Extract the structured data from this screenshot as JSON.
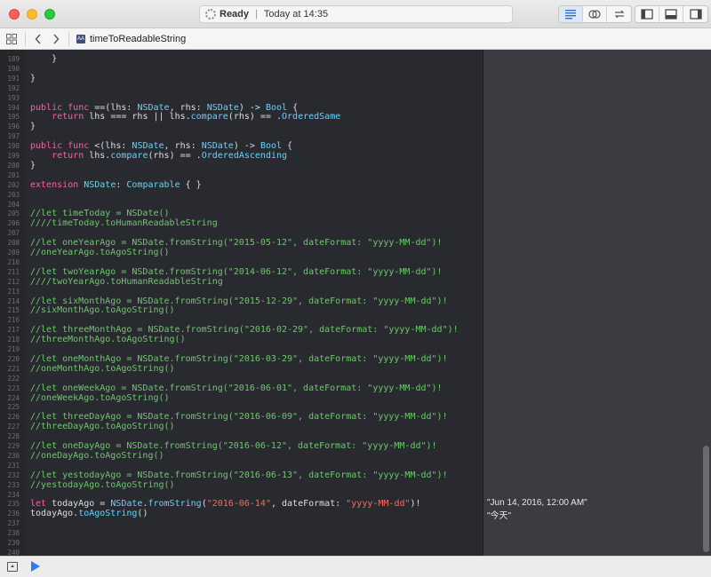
{
  "window": {
    "status": "Ready",
    "status_time": "Today at 14:35"
  },
  "jumpbar": {
    "filename": "timeToReadableString",
    "file_badge": "AA"
  },
  "editor": {
    "lines": [
      {
        "n": "189",
        "tokens": [
          {
            "t": "p",
            "v": "    }"
          }
        ]
      },
      {
        "n": "190",
        "tokens": []
      },
      {
        "n": "191",
        "tokens": [
          {
            "t": "p",
            "v": "}"
          }
        ]
      },
      {
        "n": "192",
        "tokens": []
      },
      {
        "n": "193",
        "tokens": []
      },
      {
        "n": "194",
        "tokens": [
          {
            "t": "kw",
            "v": "public"
          },
          {
            "t": "p",
            "v": " "
          },
          {
            "t": "kw",
            "v": "func"
          },
          {
            "t": "p",
            "v": " ==(lhs: "
          },
          {
            "t": "ty",
            "v": "NSDate"
          },
          {
            "t": "p",
            "v": ", rhs: "
          },
          {
            "t": "ty",
            "v": "NSDate"
          },
          {
            "t": "p",
            "v": ") -> "
          },
          {
            "t": "ty",
            "v": "Bool"
          },
          {
            "t": "p",
            "v": " {"
          }
        ]
      },
      {
        "n": "195",
        "tokens": [
          {
            "t": "p",
            "v": "    "
          },
          {
            "t": "kw",
            "v": "return"
          },
          {
            "t": "p",
            "v": " lhs === rhs || lhs."
          },
          {
            "t": "ty",
            "v": "compare"
          },
          {
            "t": "p",
            "v": "(rhs) == ."
          },
          {
            "t": "ty",
            "v": "OrderedSame"
          }
        ]
      },
      {
        "n": "196",
        "tokens": [
          {
            "t": "p",
            "v": "}"
          }
        ]
      },
      {
        "n": "197",
        "tokens": []
      },
      {
        "n": "198",
        "tokens": [
          {
            "t": "kw",
            "v": "public"
          },
          {
            "t": "p",
            "v": " "
          },
          {
            "t": "kw",
            "v": "func"
          },
          {
            "t": "p",
            "v": " <(lhs: "
          },
          {
            "t": "ty",
            "v": "NSDate"
          },
          {
            "t": "p",
            "v": ", rhs: "
          },
          {
            "t": "ty",
            "v": "NSDate"
          },
          {
            "t": "p",
            "v": ") -> "
          },
          {
            "t": "ty",
            "v": "Bool"
          },
          {
            "t": "p",
            "v": " {"
          }
        ]
      },
      {
        "n": "199",
        "tokens": [
          {
            "t": "p",
            "v": "    "
          },
          {
            "t": "kw",
            "v": "return"
          },
          {
            "t": "p",
            "v": " lhs."
          },
          {
            "t": "ty",
            "v": "compare"
          },
          {
            "t": "p",
            "v": "(rhs) == ."
          },
          {
            "t": "ty",
            "v": "OrderedAscending"
          }
        ]
      },
      {
        "n": "200",
        "tokens": [
          {
            "t": "p",
            "v": "}"
          }
        ]
      },
      {
        "n": "201",
        "tokens": []
      },
      {
        "n": "202",
        "tokens": [
          {
            "t": "kw",
            "v": "extension"
          },
          {
            "t": "p",
            "v": " "
          },
          {
            "t": "ty",
            "v": "NSDate"
          },
          {
            "t": "p",
            "v": ": "
          },
          {
            "t": "ty",
            "v": "Comparable"
          },
          {
            "t": "p",
            "v": " { }"
          }
        ]
      },
      {
        "n": "203",
        "tokens": []
      },
      {
        "n": "204",
        "tokens": []
      },
      {
        "n": "205",
        "tokens": [
          {
            "t": "cm",
            "v": "//let timeToday = NSDate()"
          }
        ]
      },
      {
        "n": "206",
        "tokens": [
          {
            "t": "cm",
            "v": "////timeToday.toHumanReadableString"
          }
        ]
      },
      {
        "n": "207",
        "tokens": []
      },
      {
        "n": "208",
        "tokens": [
          {
            "t": "cm",
            "v": "//let oneYearAgo = NSDate.fromString(\"2015-05-12\", dateFormat: \"yyyy-MM-dd\")!"
          }
        ]
      },
      {
        "n": "209",
        "tokens": [
          {
            "t": "cm",
            "v": "//oneYearAgo.toAgoString()"
          }
        ]
      },
      {
        "n": "210",
        "tokens": []
      },
      {
        "n": "211",
        "tokens": [
          {
            "t": "cm",
            "v": "//let twoYearAgo = NSDate.fromString(\"2014-06-12\", dateFormat: \"yyyy-MM-dd\")!"
          }
        ]
      },
      {
        "n": "212",
        "tokens": [
          {
            "t": "cm",
            "v": "////twoYearAgo.toHumanReadableString"
          }
        ]
      },
      {
        "n": "213",
        "tokens": []
      },
      {
        "n": "214",
        "tokens": [
          {
            "t": "cm",
            "v": "//let sixMonthAgo = NSDate.fromString(\"2015-12-29\", dateFormat: \"yyyy-MM-dd\")!"
          }
        ]
      },
      {
        "n": "215",
        "tokens": [
          {
            "t": "cm",
            "v": "//sixMonthAgo.toAgoString()"
          }
        ]
      },
      {
        "n": "216",
        "tokens": []
      },
      {
        "n": "217",
        "tokens": [
          {
            "t": "cm",
            "v": "//let threeMonthAgo = NSDate.fromString(\"2016-02-29\", dateFormat: \"yyyy-MM-dd\")!"
          }
        ]
      },
      {
        "n": "218",
        "tokens": [
          {
            "t": "cm",
            "v": "//threeMonthAgo.toAgoString()"
          }
        ]
      },
      {
        "n": "219",
        "tokens": []
      },
      {
        "n": "220",
        "tokens": [
          {
            "t": "cm",
            "v": "//let oneMonthAgo = NSDate.fromString(\"2016-03-29\", dateFormat: \"yyyy-MM-dd\")!"
          }
        ]
      },
      {
        "n": "221",
        "tokens": [
          {
            "t": "cm",
            "v": "//oneMonthAgo.toAgoString()"
          }
        ]
      },
      {
        "n": "222",
        "tokens": []
      },
      {
        "n": "223",
        "tokens": [
          {
            "t": "cm",
            "v": "//let oneWeekAgo = NSDate.fromString(\"2016-06-01\", dateFormat: \"yyyy-MM-dd\")!"
          }
        ]
      },
      {
        "n": "224",
        "tokens": [
          {
            "t": "cm",
            "v": "//oneWeekAgo.toAgoString()"
          }
        ]
      },
      {
        "n": "225",
        "tokens": []
      },
      {
        "n": "226",
        "tokens": [
          {
            "t": "cm",
            "v": "//let threeDayAgo = NSDate.fromString(\"2016-06-09\", dateFormat: \"yyyy-MM-dd\")!"
          }
        ]
      },
      {
        "n": "227",
        "tokens": [
          {
            "t": "cm",
            "v": "//threeDayAgo.toAgoString()"
          }
        ]
      },
      {
        "n": "228",
        "tokens": []
      },
      {
        "n": "229",
        "tokens": [
          {
            "t": "cm",
            "v": "//let oneDayAgo = NSDate.fromString(\"2016-06-12\", dateFormat: \"yyyy-MM-dd\")!"
          }
        ]
      },
      {
        "n": "230",
        "tokens": [
          {
            "t": "cm",
            "v": "//oneDayAgo.toAgoString()"
          }
        ]
      },
      {
        "n": "231",
        "tokens": []
      },
      {
        "n": "232",
        "tokens": [
          {
            "t": "cm",
            "v": "//let yestodayAgo = NSDate.fromString(\"2016-06-13\", dateFormat: \"yyyy-MM-dd\")!"
          }
        ]
      },
      {
        "n": "233",
        "tokens": [
          {
            "t": "cm",
            "v": "//yestodayAgo.toAgoString()"
          }
        ]
      },
      {
        "n": "234",
        "tokens": []
      },
      {
        "n": "235",
        "tokens": [
          {
            "t": "kw",
            "v": "let"
          },
          {
            "t": "p",
            "v": " todayAgo = "
          },
          {
            "t": "ty",
            "v": "NSDate"
          },
          {
            "t": "p",
            "v": "."
          },
          {
            "t": "ty",
            "v": "fromString"
          },
          {
            "t": "p",
            "v": "("
          },
          {
            "t": "st",
            "v": "\"2016-06-14\""
          },
          {
            "t": "p",
            "v": ", dateFormat: "
          },
          {
            "t": "st",
            "v": "\"yyyy-MM-dd\""
          },
          {
            "t": "p",
            "v": ")!"
          }
        ]
      },
      {
        "n": "236",
        "tokens": [
          {
            "t": "p",
            "v": "todayAgo."
          },
          {
            "t": "ty",
            "v": "toAgoString"
          },
          {
            "t": "p",
            "v": "()"
          }
        ]
      },
      {
        "n": "237",
        "tokens": []
      },
      {
        "n": "238",
        "tokens": []
      },
      {
        "n": "239",
        "tokens": []
      },
      {
        "n": "240",
        "tokens": []
      }
    ]
  },
  "results": {
    "line_235": "\"Jun 14, 2016, 12:00 AM\"",
    "line_236": "\"今天\""
  },
  "colors": {
    "editor_bg": "#292a30",
    "results_bg": "#3b3c42",
    "keyword": "#fc5fa3",
    "type": "#5dd8ff",
    "comment": "#6cc86a",
    "string": "#fc6a5d",
    "run_button": "#2f7bf5"
  }
}
